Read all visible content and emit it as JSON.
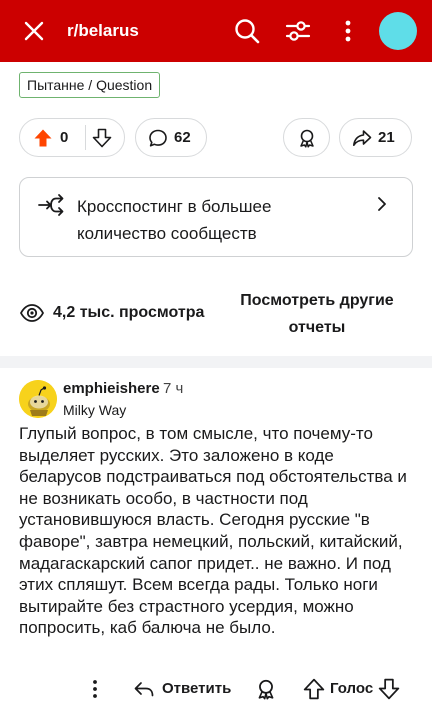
{
  "header": {
    "subreddit": "r/belarus",
    "colors": {
      "bar": "#cc0000",
      "avatar": "#5fdde8"
    }
  },
  "post": {
    "flair": "Пытанне / Question",
    "vote_count": "0",
    "comment_count": "62",
    "share_count": "21",
    "crosspost_text": "Кросспостинг в большее количество сообществ",
    "views": "4,2 тыс. просмотра",
    "more_reports": "Посмотреть другие отчеты",
    "upvote_color": "#ff4500"
  },
  "comment": {
    "author": "emphieishere",
    "time": "7 ч",
    "flair": "Milky Way",
    "body": "Глупый вопрос, в том смысле, что почему-то выделяет русских. Это заложено в коде беларусов подстраиваться под обстоятельства и не возникать особо, в частности под установившуюся власть. Сегодня русские \"в фаворе\", завтра немецкий, польский, китайский, мадагаскарский сапог придет.. не важно. И под этих спляшут. Всем всегда рады. Только ноги вытирайте без страстного усердия, можно попросить, каб балюча не было.",
    "reply_label": "Ответить",
    "vote_label": "Голос"
  }
}
